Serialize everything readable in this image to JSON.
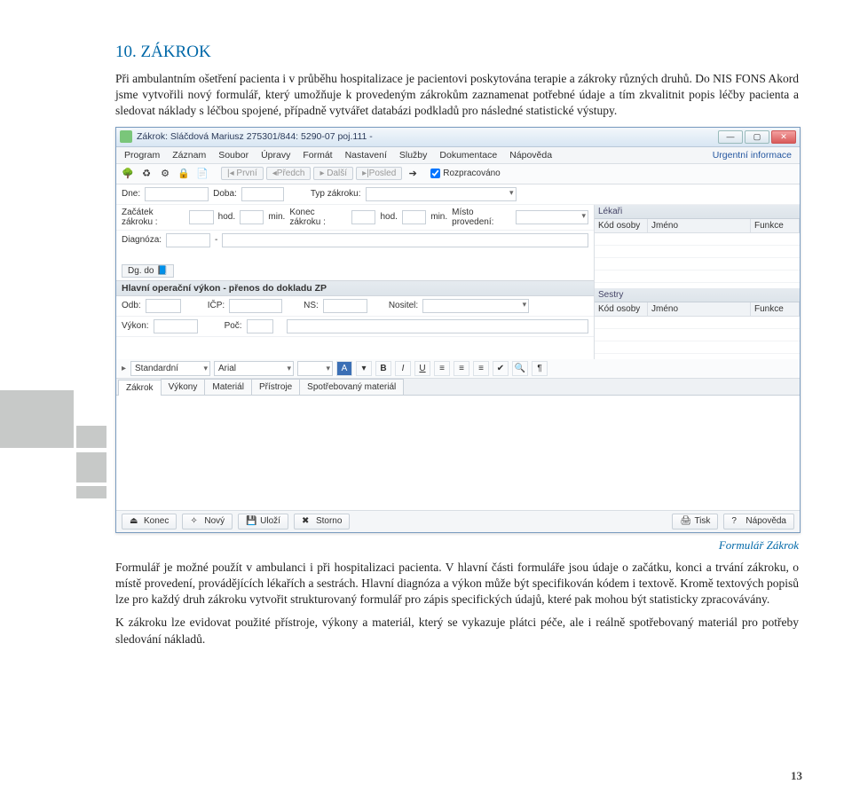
{
  "page": {
    "title": "10. ZÁKROK",
    "p1": "Při ambulantním ošetření pacienta i v průběhu hospitalizace je pacientovi poskytována terapie a zákroky různých druhů. Do NIS FONS Akord jsme vytvořili nový formulář, který umožňuje k provedeným zákrokům zaznamenat potřebné údaje a tím zkvalitnit popis léčby pacienta a sledovat náklady s léčbou spojené, případně vytvářet databázi podkladů pro následné statistické výstupy.",
    "caption": "Formulář Zákrok",
    "p2": "Formulář je možné použít v ambulanci i při hospitalizaci pacienta. V hlavní části formuláře jsou údaje o začátku, konci a trvání zákroku, o místě provedení, provádějících lékařích a sestrách. Hlavní diagnóza a výkon může být specifikován kódem i textově. Kromě textových popisů lze pro každý druh zákroku vytvořit strukturovaný formulář pro zápis specifických údajů, které pak mohou být statisticky zpracovávány.",
    "p3": "K zákroku lze evidovat použité přístroje, výkony a materiál, který se vykazuje plátci péče, ale i reálně spotřebovaný materiál pro potřeby sledování nákladů.",
    "number": "13"
  },
  "win": {
    "title": "Zákrok: Sláčdová Mariusz 275301/844: 5290-07 poj.111 -",
    "menu": [
      "Program",
      "Záznam",
      "Soubor",
      "Úpravy",
      "Formát",
      "Nastavení",
      "Služby",
      "Dokumentace",
      "Nápověda"
    ],
    "menu_right": "Urgentní informace",
    "nav": {
      "prvni": "|◂ První",
      "predch": "◂Předch",
      "dalsi": "▸ Další",
      "posled": "▸|Posled"
    },
    "rozprac_label": "Rozpracováno",
    "row1": {
      "dne": "Dne:",
      "doba": "Doba:",
      "typ": "Typ zákroku:"
    },
    "row2": {
      "zac": "Začátek zákroku :",
      "hod": "hod.",
      "min": "min.",
      "kon": "Konec zákroku :",
      "misto": "Místo provedení:"
    },
    "diag": {
      "label": "Diagnóza:",
      "dgdo": "Dg. do"
    },
    "vykon_head": "Hlavní operační výkon - přenos do dokladu ZP",
    "vykon": {
      "odb": "Odb:",
      "icp": "IČP:",
      "ns": "NS:",
      "nositel": "Nositel:",
      "vykon": "Výkon:",
      "poc": "Poč:"
    },
    "grids": {
      "lekari": "Lékaři",
      "sestry": "Sestry",
      "c1": "Kód osoby",
      "c2": "Jméno",
      "c3": "Funkce"
    },
    "rtf": {
      "style": "Standardní",
      "font": "Arial"
    },
    "tabs": [
      "Zákrok",
      "Výkony",
      "Materiál",
      "Přístroje",
      "Spotřebovaný materiál"
    ],
    "bottom": {
      "konec": "Konec",
      "novy": "Nový",
      "ulozi": "Uloží",
      "storno": "Storno",
      "tisk": "Tisk",
      "napoveda": "Nápověda"
    }
  }
}
